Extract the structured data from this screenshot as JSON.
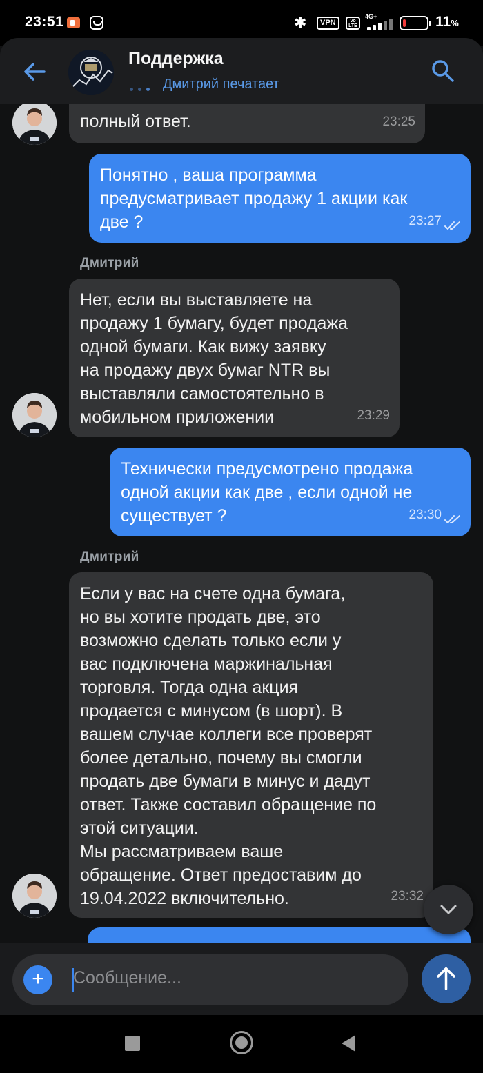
{
  "status_bar": {
    "time": "23:51",
    "vpn_label": "VPN",
    "volte_label": "Vo\nLTE",
    "network_label": "4G+",
    "battery_level": 0.11,
    "battery_percent": "11",
    "percent_sign": "%"
  },
  "header": {
    "title": "Поддержка",
    "status": "Дмитрий печатает"
  },
  "messages": [
    {
      "direction": "in",
      "text": "полный ответ.",
      "time": "23:25"
    },
    {
      "direction": "out",
      "text": "Понятно , ваша программа\nпредусматривает продажу 1 акции как\nдве ?",
      "time": "23:27",
      "read": true
    },
    {
      "direction": "in",
      "sender": "Дмитрий",
      "text": "Нет, если вы выставляете на\nпродажу 1 бумагу, будет продажа\nодной бумаги. Как вижу заявку\nна продажу двух бумаг NTR вы\nвыставляли самостоятельно в\nмобильном приложении",
      "time": "23:29"
    },
    {
      "direction": "out",
      "text": "Технически предусмотрено продажа\nодной акции как две , если одной не\nсуществует ?",
      "time": "23:30",
      "read": true
    },
    {
      "direction": "in",
      "sender": "Дмитрий",
      "text": "Если у вас на счете одна бумага,\nно вы хотите продать две, это\nвозможно сделать только если у\nвас подключена маржинальная\nторговля. Тогда одна акция\nпродается с минусом (в шорт). В\nвашем случае коллеги все проверят\nболее детально, почему вы смогли\nпродать две бумаги в минус и дадут\nответ. Также составил обращение по\nэтой ситуации.\nМы рассматриваем ваше\nобращение. Ответ предоставим до\n19.04.2022 включительно.",
      "time": "23:32"
    }
  ],
  "input": {
    "placeholder": "Сообщение..."
  },
  "colors": {
    "outgoing_bubble": "#3b86f0",
    "incoming_bubble": "#333436",
    "accent": "#5a9ae8",
    "background": "#111213"
  },
  "icons": {
    "back": "arrow-left-icon",
    "search": "search-icon",
    "attach": "plus-icon",
    "send": "arrow-up-icon",
    "scroll_down": "chevron-down-icon",
    "read_receipt": "double-check-icon"
  }
}
